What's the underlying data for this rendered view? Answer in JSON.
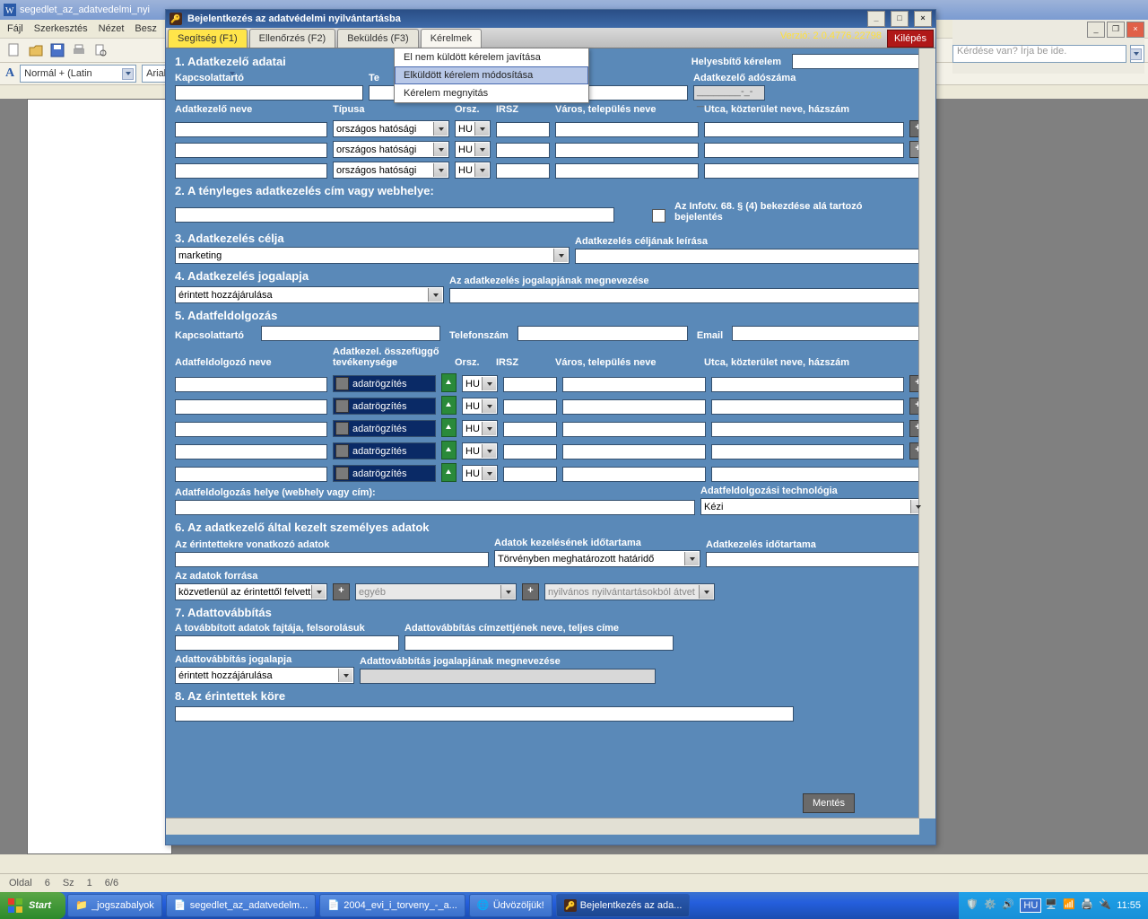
{
  "outer_doc_title": "segedlet_az_adatvedelmi_nyi",
  "menu": {
    "file": "Fájl",
    "edit": "Szerkesztés",
    "view": "Nézet",
    "insert": "Besz"
  },
  "style_combo": "Normál + (Latin",
  "font_combo": "Arial",
  "help_placeholder": "Kérdése van? Írja be ide.",
  "app": {
    "title": "Bejelentkezés az adatvédelmi nyilvántartásba",
    "tabs": {
      "help": "Segítség (F1)",
      "check": "Ellenőrzés (F2)",
      "send": "Beküldés (F3)",
      "req": "Kérelmek"
    },
    "version": "Verzió: 2.0.4776.22798",
    "exit": "Kilépés",
    "dropdown": {
      "m1": "El nem küldött kérelem javítása",
      "m2": "Elküldött kérelem módosítása",
      "m3": "Kérelem megnyitás"
    },
    "sec1": "1. Adatkezelő adatai",
    "helyesbito": "Helyesbítő kérelem",
    "lbl_kapcs": "Kapcsolattartó",
    "lbl_tel": "Te",
    "lbl_l": "l",
    "lbl_ado": "Adatkezelő adószáma",
    "ado_mask": "________-_-__",
    "lbl_nev": "Adatkezelő neve",
    "lbl_tip": "Típusa",
    "lbl_orsz": "Orsz.",
    "lbl_irsz": "IRSZ",
    "lbl_varos": "Város, település neve",
    "lbl_utca": "Utca, közterület neve, házszám",
    "tip_val": "országos hatósági",
    "hu": "HU",
    "plus": "+",
    "sec2": "2. A tényleges adatkezelés cím vagy webhelye:",
    "cb_info": "Az Infotv. 68. § (4) bekezdése alá tartozó bejelentés",
    "sec3": "3. Adatkezelés célja",
    "marketing": "marketing",
    "lbl_celleir": "Adatkezelés céljának leírása",
    "sec4": "4. Adatkezelés jogalapja",
    "jog_val": "érintett hozzájárulása",
    "lbl_jogmeg": "Az adatkezelés jogalapjának megnevezése",
    "sec5": "5. Adatfeldolgozás",
    "lbl_kapcs5": "Kapcsolattartó",
    "lbl_tel5": "Telefonszám",
    "lbl_email": "Email",
    "lbl_feldnev": "Adatfeldolgozó neve",
    "lbl_tev": "Adatkezel. összefüggő tevékenysége",
    "adatrog": "adatrögzítés",
    "lbl_feldhely": "Adatfeldolgozás helye (webhely vagy cím):",
    "lbl_tech": "Adatfeldolgozási technológia",
    "tech_val": "Kézi",
    "sec6": "6. Az adatkezelő által kezelt személyes adatok",
    "lbl_erint": "Az érintettekre vonatkozó adatok",
    "lbl_ido": "Adatok kezelésének időtartama",
    "ido_val": "Törvényben meghatározott határidő",
    "lbl_akido": "Adatkezelés időtartama",
    "lbl_forras": "Az adatok forrása",
    "forras_val": "közvetlenül az érintettől felvett",
    "egyeb": "egyéb",
    "nyilv": "nyilvános nyilvántartásokból átvet",
    "sec7": "7. Adattovábbítás",
    "lbl_tovfaj": "A továbbított adatok fajtája, felsorolásuk",
    "lbl_tovcim": "Adattovábbítás címzettjének neve, teljes címe",
    "lbl_tovjog": "Adattovábbítás jogalapja",
    "tovjog_val": "érintett hozzájárulása",
    "lbl_tovjogmeg": "Adattovábbítás jogalapjának megnevezése",
    "sec8": "8. Az érintettek köre",
    "mentes": "Mentés"
  },
  "status": {
    "oldal": "Oldal",
    "oldal_v": "6",
    "sz": "Sz",
    "sz_v": "1",
    "tot": "6/6"
  },
  "taskbar": {
    "start": "Start",
    "t1": "_jogszabalyok",
    "t2": "segedlet_az_adatvedelm...",
    "t3": "2004_evi_i_torveny_-_a...",
    "t4": "Üdvözöljük!",
    "t5": "Bejelentkezés az ada...",
    "lang": "HU",
    "time": "11:55"
  }
}
